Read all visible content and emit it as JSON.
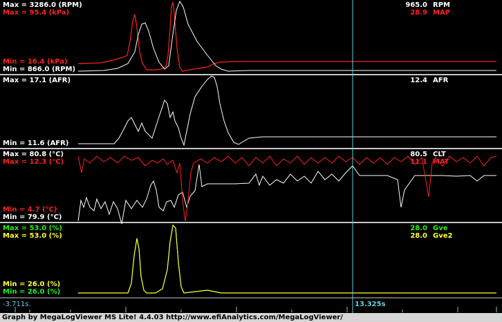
{
  "colors": {
    "white": "#ffffff",
    "red": "#ff2020",
    "green": "#22ee22",
    "yellow": "#ffff33",
    "cursor": "#66ccdd",
    "divider": "#c8c8c8"
  },
  "panels": [
    {
      "id": "rpm-map",
      "labels": {
        "max_rpm": "Max = 3286.0 (RPM)",
        "max_map": "Max = 95.4 (kPa)",
        "min_map": "Min = 16.4 (kPa)",
        "min_rpm": "Min = 866.0 (RPM)",
        "cur_rpm_value": "965.0",
        "cur_rpm_name": "RPM",
        "cur_map_value": "28.9",
        "cur_map_name": "MAP"
      }
    },
    {
      "id": "afr",
      "labels": {
        "max_afr": "Max = 17.1 (AFR)",
        "min_afr": "Min = 11.6 (AFR)",
        "cur_afr_value": "12.4",
        "cur_afr_name": "AFR"
      }
    },
    {
      "id": "clt-mat",
      "labels": {
        "max_clt": "Max = 80.8 (°C)",
        "max_mat": "Max = 12.3 (°C)",
        "min_mat": "Min = 4.7 (°C)",
        "min_clt": "Min = 79.9 (°C)",
        "cur_clt_value": "80.5",
        "cur_clt_name": "CLT",
        "cur_mat_value": "11.1",
        "cur_mat_name": "MAT"
      }
    },
    {
      "id": "gve",
      "labels": {
        "max_gve": "Max = 53.0 (%)",
        "max_gve2": "Max = 53.0 (%)",
        "min_gve": "Min = 26.0 (%)",
        "min_gve2": "Min = 26.0 (%)",
        "cur_gve_value": "28.0",
        "cur_gve_name": "Gve",
        "cur_gve2_value": "28.0",
        "cur_gve2_name": "Gve2"
      }
    }
  ],
  "timeline": {
    "start_label": "-3.711s.",
    "cursor_label": "13.325s"
  },
  "footer": "Graph by MegaLogViewer MS Lite! 4.4.03 http://www.efiAnalytics.com/MegaLogViewer/"
}
